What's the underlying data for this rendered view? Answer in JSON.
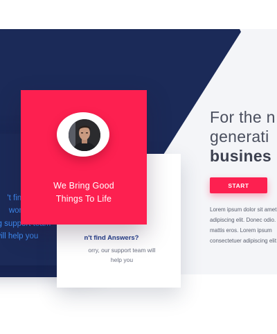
{
  "hero": {
    "line1": "For the n",
    "line2": "generati",
    "line3": "busines",
    "button_label": "START",
    "paragraph": [
      "Lorem ipsum dolor sit amet",
      "adipiscing elit. Donec odio.",
      "mattis eros. Lorem ipsum",
      "consectetuer adipiscing elit"
    ]
  },
  "card_red": {
    "title_line1": "We Bring Good",
    "title_line2": "Things To Life"
  },
  "card_white": {
    "heading": "n't find Answers?",
    "body_line1": "orry, our support team will",
    "body_line2": "help you"
  },
  "card_back": {
    "lines": [
      "'t find",
      "worr",
      "nning support team",
      "will help you"
    ]
  },
  "colors": {
    "accent": "#fd2050",
    "navy": "#1b2a58",
    "link_blue": "#3d8bf2",
    "background": "#f4f5f8"
  }
}
